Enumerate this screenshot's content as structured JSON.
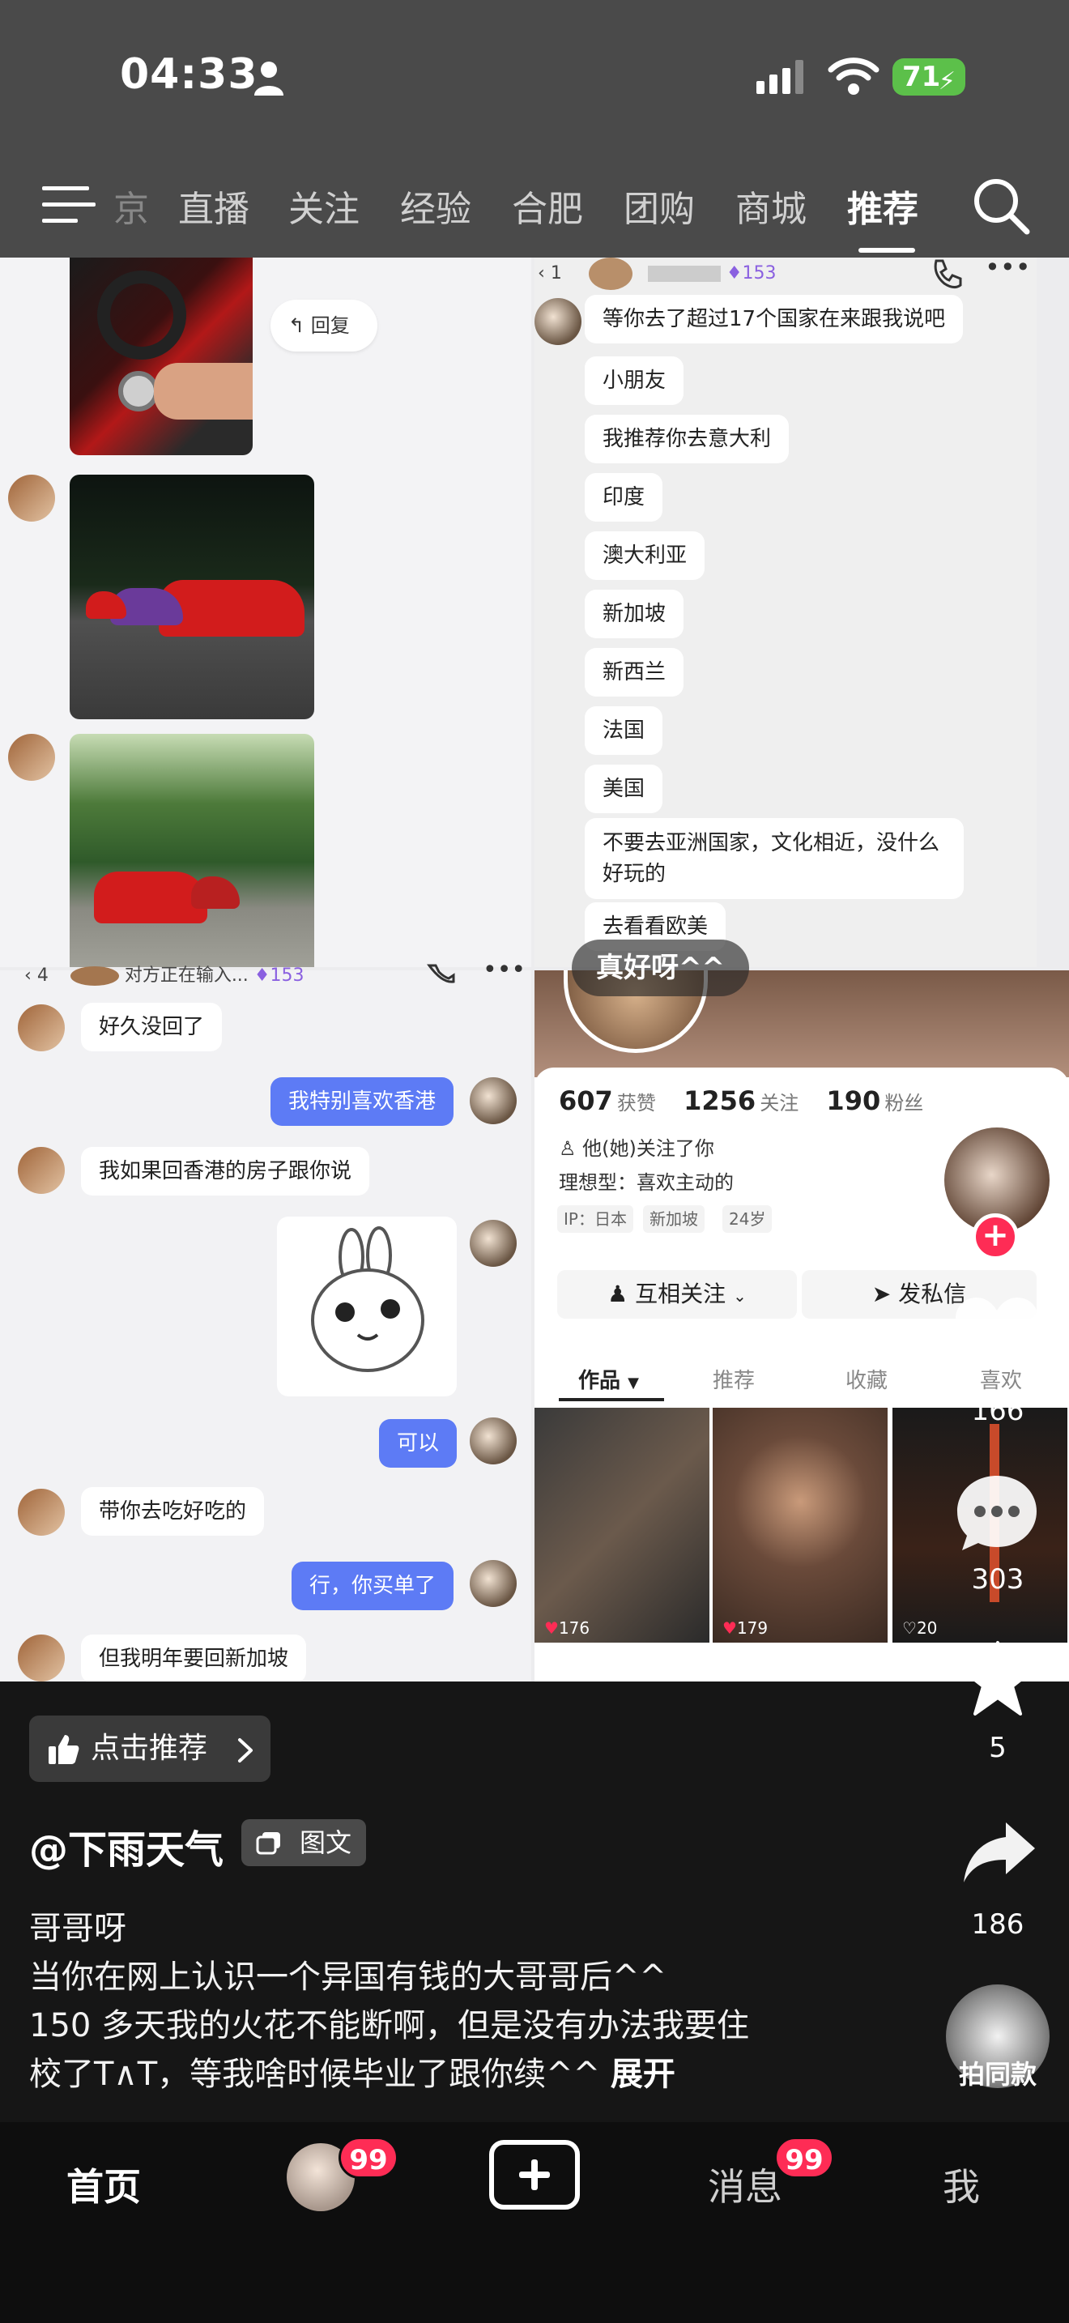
{
  "status_bar": {
    "time": "04:33",
    "battery": "71"
  },
  "top_tabs": {
    "items": [
      "京",
      "直播",
      "关注",
      "经验",
      "合肥",
      "团购",
      "商城",
      "推荐"
    ],
    "active": "推荐"
  },
  "collage": {
    "top_left": {
      "reply_label": "回复"
    },
    "top_right": {
      "header_count": "1",
      "header_level": "153",
      "messages": [
        "等你去了超过17个国家在来跟我说吧",
        "小朋友",
        "我推荐你去意大利",
        "印度",
        "澳大利亚",
        "新加坡",
        "新西兰",
        "法国",
        "美国",
        "不要去亚洲国家，文化相近，没什么好玩的",
        "去看看欧美"
      ]
    },
    "bottom_left": {
      "header_count": "4",
      "header_status": "对方正在输入...",
      "header_level": "153",
      "messages": [
        {
          "side": "left",
          "text": "好久没回了"
        },
        {
          "side": "right",
          "text": "我特别喜欢香港"
        },
        {
          "side": "left",
          "text": "我如果回香港的房子跟你说"
        },
        {
          "side": "right",
          "text": "可以"
        },
        {
          "side": "left",
          "text": "带你去吃好吃的"
        },
        {
          "side": "right",
          "text": "行，你买单了"
        },
        {
          "side": "left",
          "text": "但我明年要回新加坡"
        }
      ]
    },
    "overlay_text": "真好呀^^",
    "profile": {
      "likes": "607",
      "likes_label": "获赞",
      "following": "1256",
      "following_label": "关注",
      "fans": "190",
      "fans_label": "粉丝",
      "followed_you": "他(她)关注了你",
      "ideal_type": "理想型：喜欢主动的",
      "chips": [
        "IP：日本",
        "新加坡",
        "24岁"
      ],
      "mutual_button": "互相关注",
      "message_button": "发私信",
      "tabs": [
        "作品",
        "推荐",
        "收藏",
        "喜欢"
      ],
      "active_tab": "作品",
      "grid_likes": [
        "176",
        "179",
        "20"
      ]
    }
  },
  "actions": {
    "likes": "166",
    "comments": "303",
    "favorites": "5",
    "shares": "186",
    "same_style_label": "拍同款"
  },
  "caption": {
    "recommend_label": "点击推荐",
    "author": "@下雨天气",
    "type_label": "图文",
    "lines": [
      "哥哥呀",
      "当你在网上认识一个异国有钱的大哥哥后^^",
      "150 多天我的火花不能断啊，但是没有办法我要住",
      "校了T∧T，等我啥时候毕业了跟你续^^"
    ],
    "expand_label": "展开"
  },
  "bottom_nav": {
    "home": "首页",
    "friends_badge": "99",
    "messages": "消息",
    "messages_badge": "99",
    "me": "我"
  }
}
